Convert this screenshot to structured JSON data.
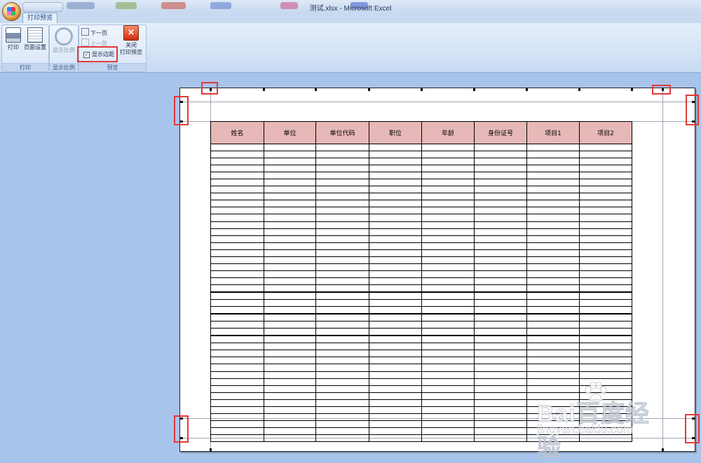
{
  "window": {
    "title": "测试.xlsx - Microsoft Excel"
  },
  "tabs": [
    {
      "label": "打印预览",
      "active": true
    }
  ],
  "ribbon": {
    "groups": [
      {
        "label": "打印",
        "buttons": [
          {
            "label": "打印",
            "icon": "printer-icon"
          },
          {
            "label": "页面设置",
            "icon": "page-setup-icon"
          }
        ]
      },
      {
        "label": "显示比例",
        "buttons": [
          {
            "label": "显示比例",
            "icon": "zoom-icon",
            "disabled": true
          }
        ]
      },
      {
        "label": "预览",
        "next_page": "下一页",
        "prev_page": "上一页",
        "show_margins": "显示边距",
        "show_margins_checked": true,
        "close_line1": "关闭",
        "close_line2": "打印预览"
      }
    ]
  },
  "sheet": {
    "headers": [
      "姓名",
      "单位",
      "单位代码",
      "职位",
      "年龄",
      "身份证号",
      "项目1",
      "项目2"
    ],
    "header_fill": "#e6b8b7",
    "empty_rows": 42
  },
  "colors": {
    "background": "#a9c4ea",
    "highlight": "#e03a3a"
  },
  "watermark": {
    "logo": "Bai百度经验",
    "url": "jingyan.baidu.com"
  }
}
